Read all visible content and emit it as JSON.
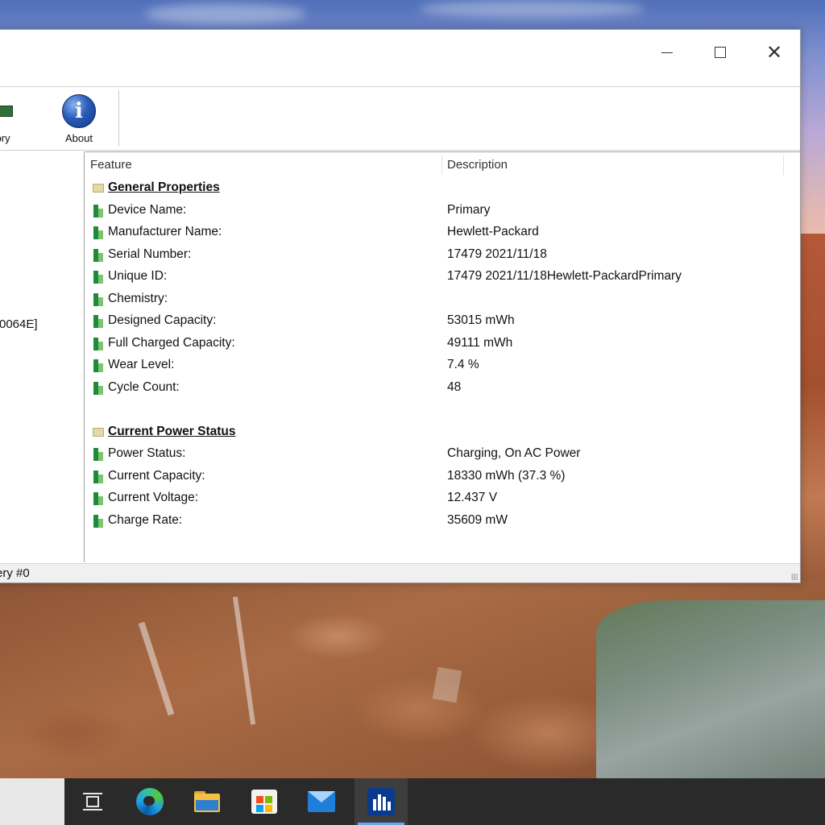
{
  "window": {
    "title_controls": {
      "minimize": "minimize",
      "maximize": "maximize",
      "close": "✕"
    }
  },
  "toolbar": {
    "memory_label": "nory",
    "about_label": "About",
    "about_glyph": "i"
  },
  "tree": {
    "selected_item": "0064E]"
  },
  "list": {
    "columns": {
      "feature": "Feature",
      "description": "Description"
    },
    "groups": [
      {
        "title": "General Properties",
        "rows": [
          {
            "feature": "Device Name:",
            "description": "Primary"
          },
          {
            "feature": "Manufacturer Name:",
            "description": "Hewlett-Packard"
          },
          {
            "feature": "Serial Number:",
            "description": "17479 2021/11/18"
          },
          {
            "feature": "Unique ID:",
            "description": "17479 2021/11/18Hewlett-PackardPrimary"
          },
          {
            "feature": "Chemistry:",
            "description": ""
          },
          {
            "feature": "Designed Capacity:",
            "description": "53015 mWh"
          },
          {
            "feature": "Full Charged Capacity:",
            "description": "49111 mWh"
          },
          {
            "feature": "Wear Level:",
            "description": "7.4 %"
          },
          {
            "feature": "Cycle Count:",
            "description": "48"
          }
        ]
      },
      {
        "title": "Current Power Status",
        "rows": [
          {
            "feature": "Power Status:",
            "description": "Charging, On AC Power"
          },
          {
            "feature": "Current Capacity:",
            "description": "18330 mWh (37.3 %)"
          },
          {
            "feature": "Current Voltage:",
            "description": "12.437 V"
          },
          {
            "feature": "Charge Rate:",
            "description": "35609 mW"
          }
        ]
      }
    ]
  },
  "statusbar": {
    "text": "ery #0"
  },
  "taskbar": {
    "items": [
      {
        "icon": "task-view-icon"
      },
      {
        "icon": "edge-icon"
      },
      {
        "icon": "file-explorer-icon"
      },
      {
        "icon": "microsoft-store-icon"
      },
      {
        "icon": "mail-icon"
      },
      {
        "icon": "batteryinfoview-icon",
        "active": true
      }
    ]
  },
  "colors": {
    "accent": "#6aa9e8",
    "taskbar": "#2a2a2a",
    "battery_green": "#1e8a3a"
  }
}
